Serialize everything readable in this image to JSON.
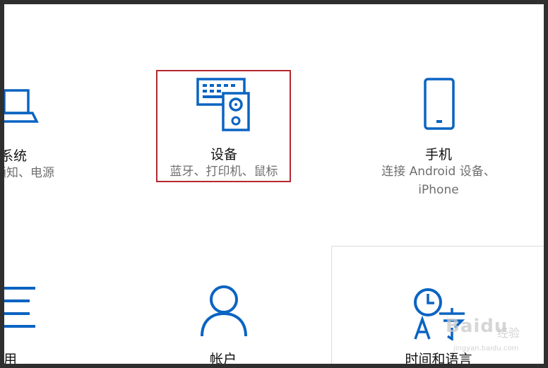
{
  "accent_color": "#0a64c2",
  "highlight_color": "#b5272d",
  "tiles": {
    "system": {
      "title": "系统",
      "subtitle": "通知、电源",
      "icon": "laptop-icon"
    },
    "devices": {
      "title": "设备",
      "subtitle": "蓝牙、打印机、鼠标",
      "icon": "keyboard-speaker-icon"
    },
    "phone": {
      "title": "手机",
      "subtitle_line1": "连接 Android 设备、",
      "subtitle_line2": "iPhone",
      "icon": "phone-icon"
    },
    "apps": {
      "title": "应用",
      "icon": "list-icon"
    },
    "accounts": {
      "title": "帐户",
      "icon": "person-icon"
    },
    "time_language": {
      "title": "时间和语言",
      "icon": "clock-language-icon"
    }
  },
  "watermark": {
    "brand": "Baidu",
    "sub": "经验",
    "url": "jingyan.baidu.com"
  }
}
